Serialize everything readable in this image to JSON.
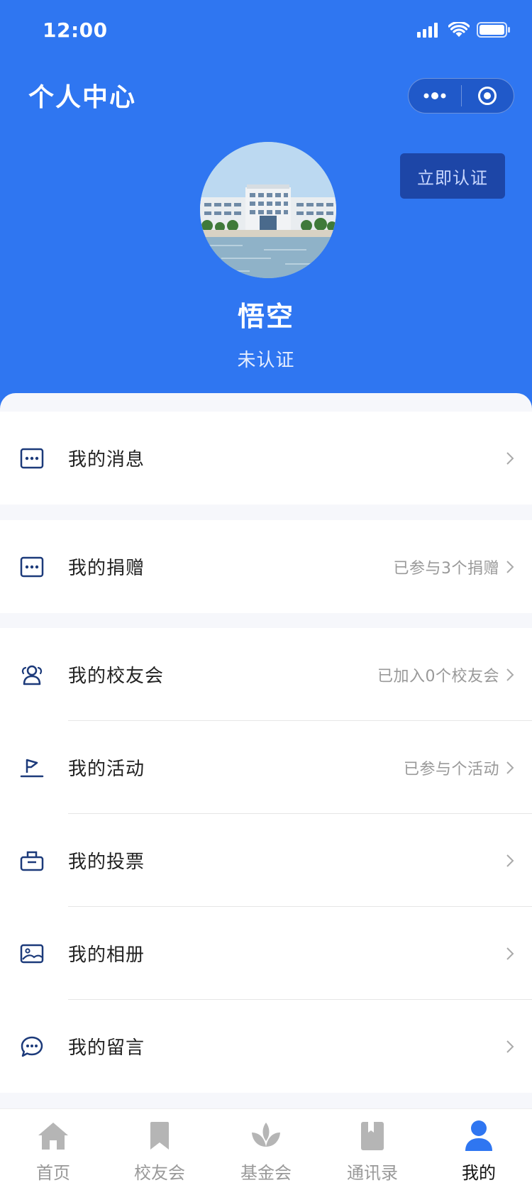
{
  "colors": {
    "primary": "#2f76f1",
    "certify_bg": "#1d46a7",
    "icon_navy": "#1c3a7a",
    "muted": "#999999"
  },
  "status_bar": {
    "time": "12:00"
  },
  "header": {
    "title": "个人中心",
    "certify_button": "立即认证",
    "user": {
      "name": "悟空",
      "status": "未认证"
    }
  },
  "menu": {
    "messages": {
      "label": "我的消息",
      "extra": "",
      "icon": "message-icon"
    },
    "donations": {
      "label": "我的捐赠",
      "extra": "已参与3个捐赠",
      "icon": "message-icon"
    },
    "alumni": {
      "label": "我的校友会",
      "extra": "已加入0个校友会",
      "icon": "people-icon"
    },
    "activities": {
      "label": "我的活动",
      "extra": "已参与个活动",
      "icon": "flag-icon"
    },
    "votes": {
      "label": "我的投票",
      "extra": "",
      "icon": "ballot-box-icon"
    },
    "albums": {
      "label": "我的相册",
      "extra": "",
      "icon": "picture-icon"
    },
    "comments": {
      "label": "我的留言",
      "extra": "",
      "icon": "chat-bubble-icon"
    }
  },
  "tabbar": {
    "items": [
      {
        "label": "首页",
        "icon": "home-icon",
        "active": false
      },
      {
        "label": "校友会",
        "icon": "bookmark-icon",
        "active": false
      },
      {
        "label": "基金会",
        "icon": "lotus-icon",
        "active": false
      },
      {
        "label": "通讯录",
        "icon": "contacts-book-icon",
        "active": false
      },
      {
        "label": "我的",
        "icon": "person-icon",
        "active": true
      }
    ]
  }
}
